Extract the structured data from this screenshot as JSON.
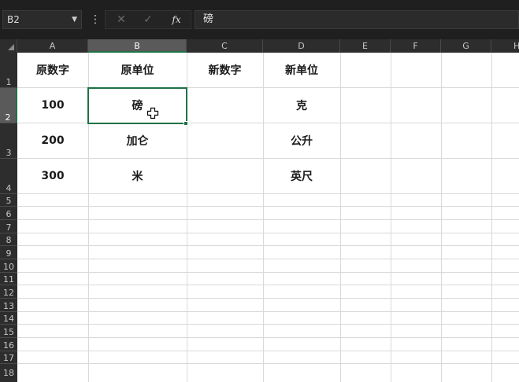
{
  "formula_bar": {
    "name_box": "B2",
    "menu_icon": "more-vertical-icon",
    "cancel_icon": "close-icon",
    "enter_icon": "check-icon",
    "function_label": "fx",
    "content": "磅"
  },
  "columns": [
    "A",
    "B",
    "C",
    "D",
    "E",
    "F",
    "G",
    "H"
  ],
  "rows": [
    "1",
    "2",
    "3",
    "4",
    "5",
    "6",
    "7",
    "8",
    "9",
    "10",
    "11",
    "12",
    "13",
    "14",
    "15",
    "16",
    "17",
    "18"
  ],
  "selected_cell": "B2",
  "cells": {
    "A1": "原数字",
    "B1": "原单位",
    "C1": "新数字",
    "D1": "新单位",
    "A2": "100",
    "B2": "磅",
    "C2": "",
    "D2": "克",
    "A3": "200",
    "B3": "加仑",
    "C3": "",
    "D3": "公升",
    "A4": "300",
    "B4": "米",
    "C4": "",
    "D4": "英尺"
  },
  "colors": {
    "accent": "#1e7145",
    "toolbar_bg": "#1f1f1f",
    "header_bg": "#2d2d2d",
    "selected_header_bg": "#5a5a5a",
    "gridline": "#d9d9d9"
  }
}
